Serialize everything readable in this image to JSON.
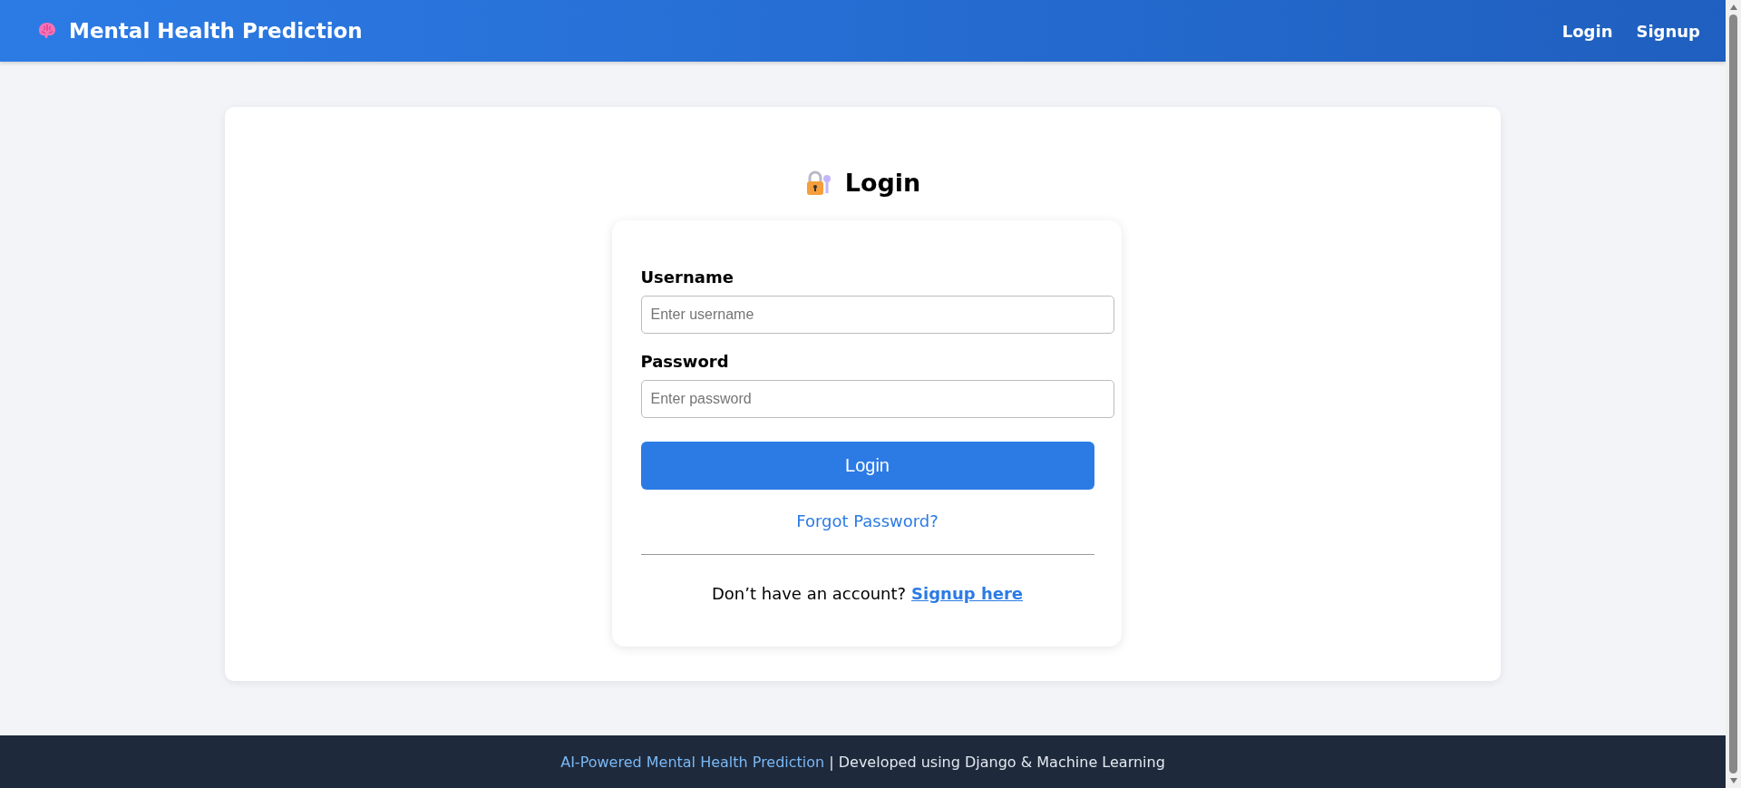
{
  "navbar": {
    "brand": "Mental Health Prediction",
    "links": [
      {
        "label": "Login"
      },
      {
        "label": "Signup"
      }
    ]
  },
  "login": {
    "title": "Login",
    "fields": [
      {
        "label": "Username",
        "placeholder": "Enter username"
      },
      {
        "label": "Password",
        "placeholder": "Enter password"
      }
    ],
    "submit": "Login",
    "forgot": "Forgot Password?",
    "signup_prompt": "Don’t have an account?",
    "signup_link": "Signup here"
  },
  "footer": {
    "highlight": "AI-Powered Mental Health Prediction",
    "text": "| Developed using Django & Machine Learning"
  }
}
